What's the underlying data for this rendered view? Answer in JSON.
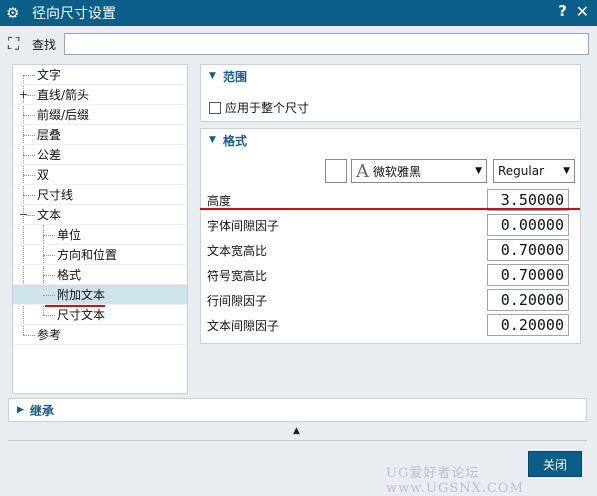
{
  "window": {
    "title": "径向尺寸设置",
    "help_label": "?",
    "close_label": "✕",
    "icon": "gear-icon"
  },
  "find": {
    "icon": "binoculars-icon",
    "label": "查找",
    "value": ""
  },
  "tree": {
    "items": [
      {
        "label": "文字",
        "level": 0,
        "expander": ""
      },
      {
        "label": "直线/箭头",
        "level": 0,
        "expander": "+"
      },
      {
        "label": "前缀/后缀",
        "level": 0,
        "expander": ""
      },
      {
        "label": "层叠",
        "level": 0,
        "expander": ""
      },
      {
        "label": "公差",
        "level": 0,
        "expander": ""
      },
      {
        "label": "双",
        "level": 0,
        "expander": ""
      },
      {
        "label": "尺寸线",
        "level": 0,
        "expander": ""
      },
      {
        "label": "文本",
        "level": 0,
        "expander": "−"
      },
      {
        "label": "单位",
        "level": 1,
        "expander": ""
      },
      {
        "label": "方向和位置",
        "level": 1,
        "expander": ""
      },
      {
        "label": "格式",
        "level": 1,
        "expander": ""
      },
      {
        "label": "附加文本",
        "level": 1,
        "expander": "",
        "selected": true
      },
      {
        "label": "尺寸文本",
        "level": 1,
        "expander": ""
      },
      {
        "label": "参考",
        "level": 0,
        "expander": ""
      }
    ]
  },
  "scope": {
    "title": "范围",
    "checkbox_label": "应用于整个尺寸",
    "checked": false
  },
  "format": {
    "title": "格式",
    "font_name": "微软雅黑",
    "font_icon": "A",
    "style": "Regular",
    "rows": [
      {
        "label": "高度",
        "value": "3.50000"
      },
      {
        "label": "字体间隙因子",
        "value": "0.00000"
      },
      {
        "label": "文本宽高比",
        "value": "0.70000"
      },
      {
        "label": "符号宽高比",
        "value": "0.70000"
      },
      {
        "label": "行间隙因子",
        "value": "0.20000"
      },
      {
        "label": "文本间隙因子",
        "value": "0.20000"
      }
    ]
  },
  "inherit": {
    "title": "继承"
  },
  "footer": {
    "watermark": "UG爱好者论坛 www.UGSNX.COM",
    "close_button": "关闭"
  },
  "colors": {
    "titlebar": "#0b5e87",
    "section_title": "#1a5a86",
    "selection": "#cfe3ec",
    "annotation_red": "#d01010"
  }
}
